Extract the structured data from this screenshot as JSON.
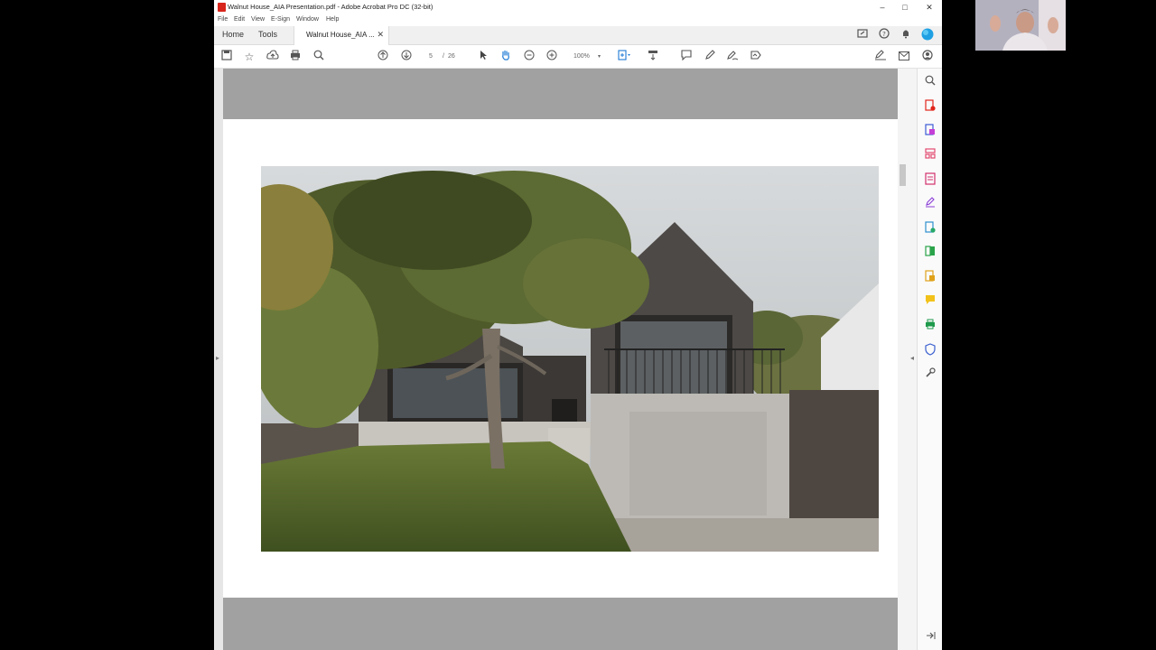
{
  "window": {
    "title": "Walnut House_AIA Presentation.pdf - Adobe Acrobat Pro DC (32-bit)",
    "minimize": "–",
    "maximize": "□",
    "close": "✕"
  },
  "menu": [
    "File",
    "Edit",
    "View",
    "E-Sign",
    "Window",
    "Help"
  ],
  "tabs": {
    "home": "Home",
    "tools": "Tools",
    "document": "Walnut House_AIA ...",
    "close": "✕"
  },
  "toolbar": {
    "current_page": "5",
    "separator": "/",
    "total_pages": "26",
    "zoom": "100%"
  },
  "icons": {
    "save": "save-icon",
    "bookmark": "star-icon",
    "upload": "cloud-upload-icon",
    "print": "print-icon",
    "search": "search-icon",
    "prev": "arrow-up-icon",
    "next": "arrow-down-icon",
    "select": "pointer-icon",
    "hand": "hand-icon",
    "zoom_out": "zoom-out-icon",
    "zoom_in": "zoom-in-icon",
    "fit": "fit-page-icon",
    "scroll": "scroll-mode-icon",
    "comment": "comment-icon",
    "highlight": "pen-icon",
    "draw": "draw-icon",
    "sign": "sign-icon",
    "fill_sign": "fill-sign-icon",
    "email": "mail-icon",
    "account": "account-icon"
  },
  "colors": {
    "acrobat_red": "#d8261c",
    "page_band": "#a1a1a1",
    "sky": "#cfd3d6",
    "grass": "#55682c",
    "cladding": "#4a4642",
    "concrete": "#bdbab5"
  }
}
